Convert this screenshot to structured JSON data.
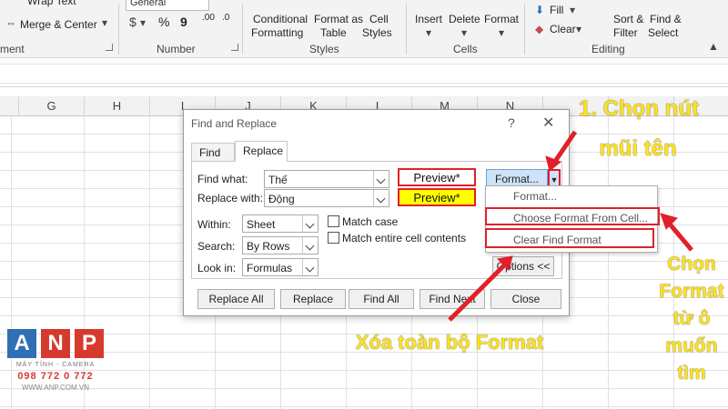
{
  "ribbon": {
    "wrap_text": "Wrap Text",
    "merge_center": "Merge & Center",
    "number_format": "General",
    "percent": "%",
    "comma": "9",
    "inc_decimal": ".00",
    "dec_decimal": ".0",
    "conditional_formatting": [
      "Conditional",
      "Formatting"
    ],
    "format_as_table": [
      "Format as",
      "Table"
    ],
    "cell_styles": [
      "Cell",
      "Styles"
    ],
    "insert": "Insert",
    "delete": "Delete",
    "format": "Format",
    "fill": "Fill",
    "clear": "Clear",
    "sort_filter": [
      "Sort &",
      "Filter"
    ],
    "find_select": [
      "Find &",
      "Select"
    ],
    "groups": {
      "alignment": "ment",
      "number": "Number",
      "styles": "Styles",
      "cells": "Cells",
      "editing": "Editing"
    }
  },
  "columns": [
    "G",
    "H",
    "I",
    "J",
    "K",
    "L",
    "M",
    "N"
  ],
  "dialog": {
    "title": "Find and Replace",
    "help": "?",
    "close": "✕",
    "tabs": [
      "Find",
      "Replace"
    ],
    "active_tab": "Replace",
    "find_what_label": "Find what:",
    "find_what_value": "Thế",
    "replace_with_label": "Replace with:",
    "replace_with_value": "Động",
    "preview_find": "Preview*",
    "preview_replace": "Preview*",
    "format_button": "Format...",
    "within_label": "Within:",
    "within_value": "Sheet",
    "search_label": "Search:",
    "search_value": "By Rows",
    "lookin_label": "Look in:",
    "lookin_value": "Formulas",
    "match_case": "Match case",
    "match_entire": "Match entire cell contents",
    "options_button": "Options <<",
    "buttons": [
      "Replace All",
      "Replace",
      "Find All",
      "Find Next",
      "Close"
    ]
  },
  "format_menu": [
    "Format...",
    "Choose Format From Cell...",
    "Clear Find Format"
  ],
  "annotations": {
    "step1": [
      "1. Chọn nút",
      "mũi tên"
    ],
    "choose_from_cell": [
      "Chọn",
      "Format",
      "từ ô",
      "muốn",
      "tìm"
    ],
    "clear_all": "Xóa toàn bộ Format"
  },
  "logo": {
    "letters": [
      "A",
      "N",
      "P"
    ],
    "tagline": "MÁY TÍNH - CAMERA",
    "phone": "098 772 0 772",
    "website": "WWW.ANP.COM.VN"
  },
  "colors": {
    "annotation_text": "#ffe21a",
    "highlight_red": "#e0202a",
    "preview_yellow": "#ffff00",
    "logo_blue": "#2f6fb4",
    "logo_red": "#d63a2e"
  }
}
